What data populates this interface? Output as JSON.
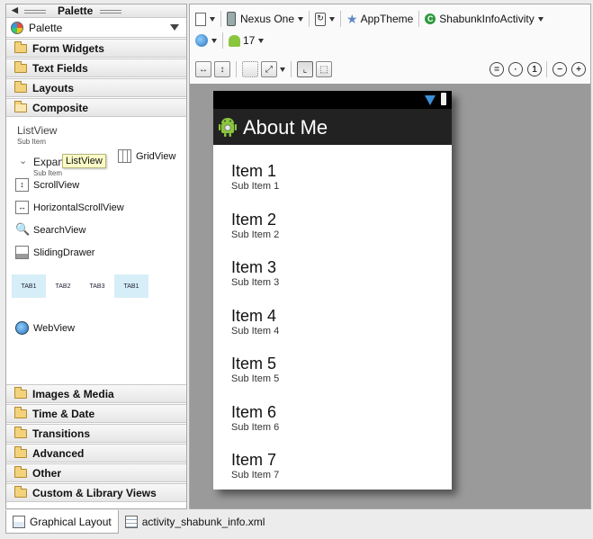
{
  "palette": {
    "title": "Palette",
    "selector_label": "Palette",
    "categories_top": [
      "Form Widgets",
      "Text Fields",
      "Layouts",
      "Composite"
    ],
    "composite": {
      "listview_title": "ListView",
      "listview_sub": "Sub Item",
      "expandable_title": "Expan",
      "expandable_sub": "Sub Item",
      "tooltip": "ListView",
      "gridview": "GridView",
      "scrollview": "ScrollView",
      "horizontalscrollview": "HorizontalScrollView",
      "searchview": "SearchView",
      "slidingdrawer": "SlidingDrawer",
      "tabs": [
        "TAB1",
        "TAB2",
        "TAB3",
        "TAB1"
      ],
      "webview": "WebView"
    },
    "categories_bottom": [
      "Images & Media",
      "Time & Date",
      "Transitions",
      "Advanced",
      "Other",
      "Custom & Library Views"
    ]
  },
  "toolbar": {
    "device": "Nexus One",
    "theme": "AppTheme",
    "activity": "ShabunkInfoActivity",
    "api_level": "17"
  },
  "device_preview": {
    "app_title": "About Me",
    "items": [
      {
        "title": "Item 1",
        "sub": "Sub Item 1"
      },
      {
        "title": "Item 2",
        "sub": "Sub Item 2"
      },
      {
        "title": "Item 3",
        "sub": "Sub Item 3"
      },
      {
        "title": "Item 4",
        "sub": "Sub Item 4"
      },
      {
        "title": "Item 5",
        "sub": "Sub Item 5"
      },
      {
        "title": "Item 6",
        "sub": "Sub Item 6"
      },
      {
        "title": "Item 7",
        "sub": "Sub Item 7"
      }
    ]
  },
  "bottom_tabs": [
    "Graphical Layout",
    "activity_shabunk_info.xml"
  ],
  "colors": {
    "canvas_bg": "#9a9a9a",
    "actionbar_bg": "#222222",
    "statusbar_bg": "#000000",
    "tab_selected_bg": "#d6eef8",
    "tooltip_bg": "#fbfbc8"
  }
}
